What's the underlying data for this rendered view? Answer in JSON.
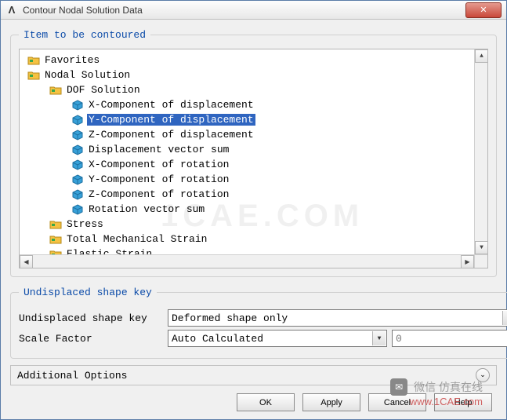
{
  "window": {
    "title": "Contour Nodal Solution Data",
    "close_glyph": "✕"
  },
  "group1": {
    "legend": "Item to be contoured"
  },
  "tree": [
    {
      "indent": 0,
      "icon": "folder",
      "label": "Favorites",
      "selected": false
    },
    {
      "indent": 0,
      "icon": "folder",
      "label": "Nodal Solution",
      "selected": false
    },
    {
      "indent": 1,
      "icon": "folder",
      "label": "DOF Solution",
      "selected": false
    },
    {
      "indent": 2,
      "icon": "cube",
      "label": "X-Component of displacement",
      "selected": false
    },
    {
      "indent": 2,
      "icon": "cube",
      "label": "Y-Component of displacement",
      "selected": true
    },
    {
      "indent": 2,
      "icon": "cube",
      "label": "Z-Component of displacement",
      "selected": false
    },
    {
      "indent": 2,
      "icon": "cube",
      "label": "Displacement vector sum",
      "selected": false
    },
    {
      "indent": 2,
      "icon": "cube",
      "label": "X-Component of rotation",
      "selected": false
    },
    {
      "indent": 2,
      "icon": "cube",
      "label": "Y-Component of rotation",
      "selected": false
    },
    {
      "indent": 2,
      "icon": "cube",
      "label": "Z-Component of rotation",
      "selected": false
    },
    {
      "indent": 2,
      "icon": "cube",
      "label": "Rotation vector sum",
      "selected": false
    },
    {
      "indent": 1,
      "icon": "folder",
      "label": "Stress",
      "selected": false
    },
    {
      "indent": 1,
      "icon": "folder",
      "label": "Total Mechanical Strain",
      "selected": false
    },
    {
      "indent": 1,
      "icon": "folder",
      "label": "Elastic Strain",
      "selected": false
    }
  ],
  "scroll": {
    "up": "▲",
    "down": "▼",
    "left": "◀",
    "right": "▶"
  },
  "group2": {
    "legend": "Undisplaced shape key",
    "row1_label": "Undisplaced shape key",
    "row1_value": "Deformed shape only",
    "row2_label": "Scale Factor",
    "row2_value": "Auto Calculated",
    "row2_num": "0"
  },
  "addopts": {
    "label": "Additional Options",
    "expand_glyph": "⌄"
  },
  "buttons": {
    "ok": "OK",
    "apply": "Apply",
    "cancel": "Cancel",
    "help": "Help"
  },
  "watermark": {
    "text": "微信    仿真在线",
    "url": "www.1CAE.com",
    "bg": "1CAE.COM"
  }
}
